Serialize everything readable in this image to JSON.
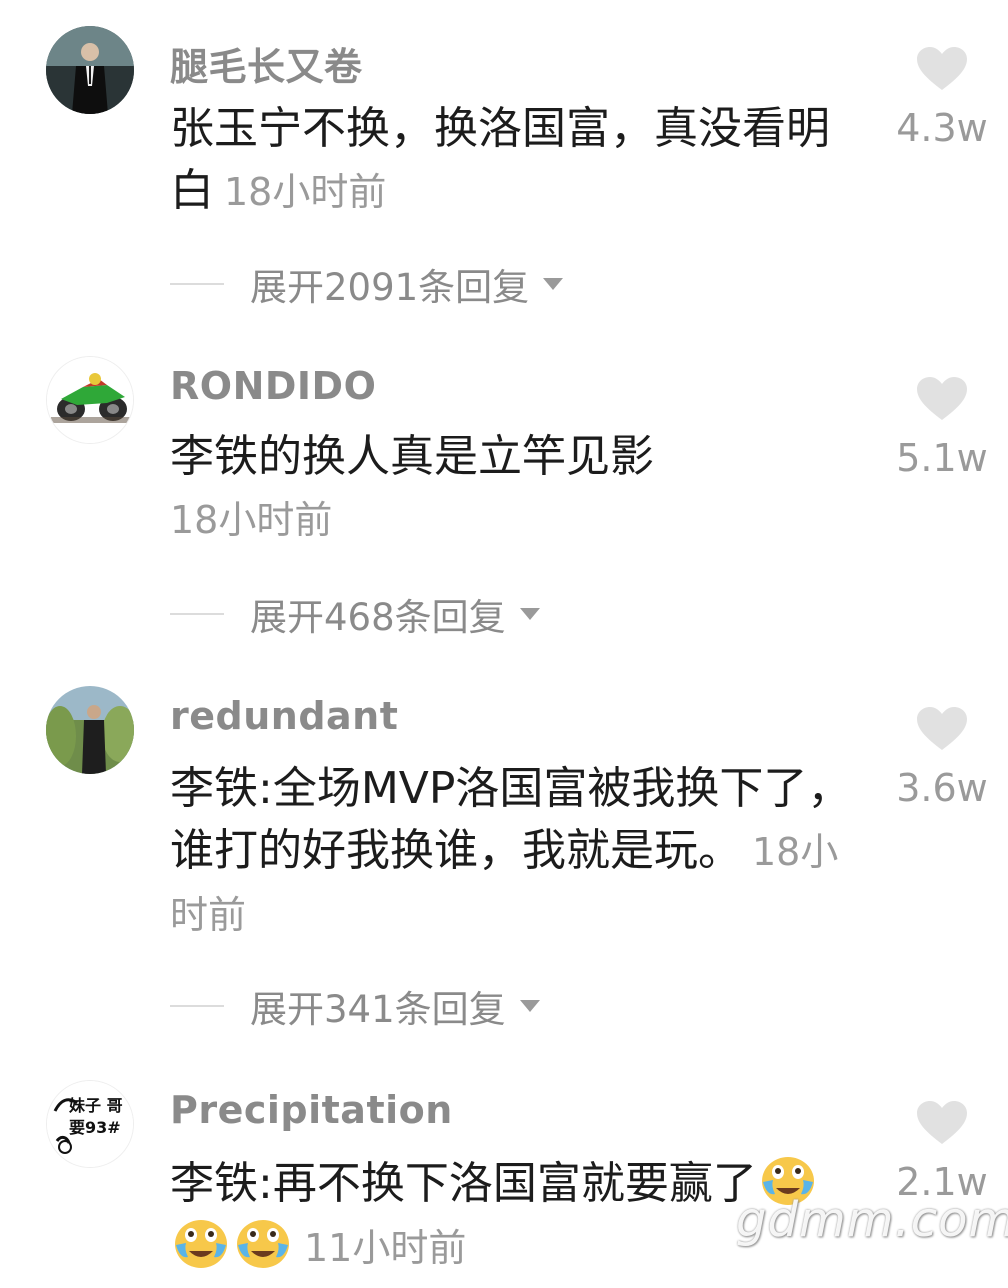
{
  "colors": {
    "username": "#8a8a8a",
    "body_text": "#1c1c1c",
    "meta_text": "#9a9a9a",
    "heart": "#e1e1e1"
  },
  "comments": [
    {
      "username": "腿毛长又卷",
      "text": "张玉宁不换，换洛国富，真没看明白",
      "time": "18小时前",
      "likes": "4.3w",
      "replies_label": "展开2091条回复",
      "avatar_icon": "man-in-suit-avatar"
    },
    {
      "username": "RONDIDO",
      "text": "李铁的换人真是立竿见影",
      "time": "18小时前",
      "likes": "5.1w",
      "replies_label": "展开468条回复",
      "avatar_icon": "motorcycle-avatar"
    },
    {
      "username": "redundant",
      "text": "李铁:全场MVP洛国富被我换下了，谁打的好我换谁，我就是玩。",
      "time": "18小时前",
      "likes": "3.6w",
      "replies_label": "展开341条回复",
      "avatar_icon": "person-outdoors-avatar"
    },
    {
      "username": "Precipitation",
      "text": "李铁:再不换下洛国富就要赢了",
      "time": "11小时前",
      "likes": "2.1w",
      "replies_label": "",
      "avatar_icon": "handwriting-avatar",
      "avatar_text": "妹子 哥要93#",
      "emoji": "crying-laughing-emoji"
    }
  ],
  "watermark": "gdmm.com"
}
